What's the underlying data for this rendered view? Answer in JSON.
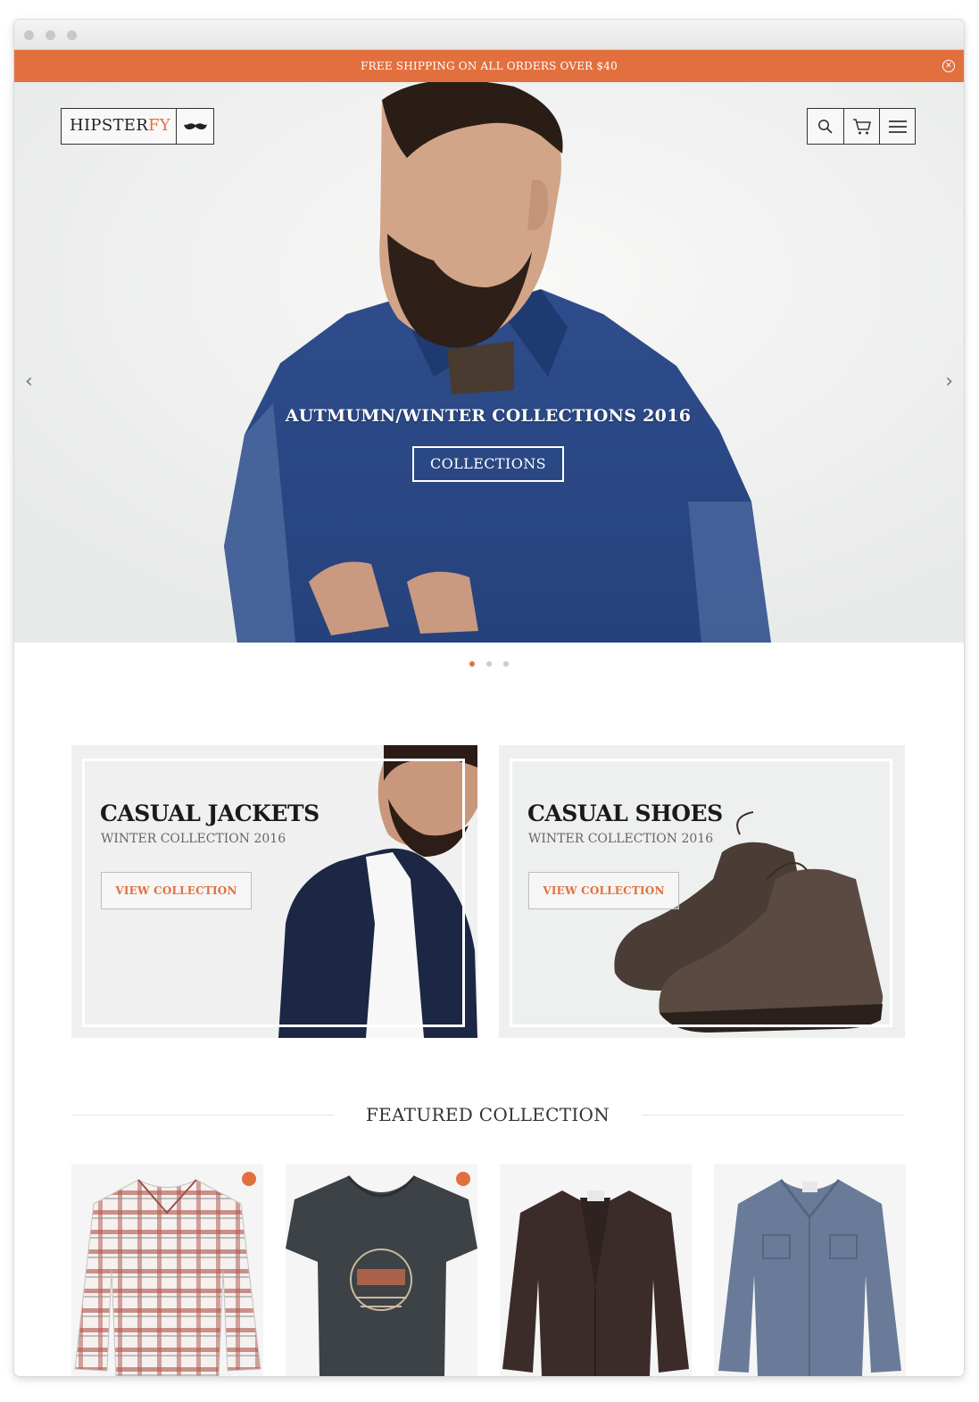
{
  "window": {
    "controls": [
      "close",
      "minimize",
      "zoom"
    ]
  },
  "announcement": {
    "text": "FREE SHIPPING ON ALL ORDERS OVER $40",
    "close_icon": "close-circle-icon"
  },
  "header": {
    "logo": {
      "text_main": "HIPSTER",
      "text_accent": "FY",
      "mark_icon": "mustache-icon"
    },
    "actions": [
      {
        "name": "search",
        "icon": "search-icon"
      },
      {
        "name": "cart",
        "icon": "cart-icon"
      },
      {
        "name": "menu",
        "icon": "hamburger-menu-icon"
      }
    ]
  },
  "hero": {
    "title": "AUTMUMN/WINTER COLLECTIONS 2016",
    "button_label": "COLLECTIONS",
    "prev_icon": "chevron-left-icon",
    "next_icon": "chevron-right-icon",
    "slides_count": 3,
    "active_slide": 1
  },
  "collections": [
    {
      "title": "CASUAL JACKETS",
      "subtitle": "WINTER COLLECTION 2016",
      "button_label": "VIEW COLLECTION"
    },
    {
      "title": "CASUAL SHOES",
      "subtitle": "WINTER COLLECTION 2016",
      "button_label": "VIEW COLLECTION"
    }
  ],
  "featured": {
    "title": "FEATURED COLLECTION",
    "products": [
      {
        "image": "plaid-flannel-shirt",
        "on_sale": true
      },
      {
        "image": "graphic-v-neck-tee",
        "on_sale": true
      },
      {
        "image": "brown-knit-cardigan",
        "on_sale": false
      },
      {
        "image": "blue-chambray-shirt",
        "on_sale": false
      }
    ]
  },
  "colors": {
    "accent": "#e2703f",
    "text_dark": "#1a1a1a",
    "text_muted": "#666666",
    "background": "#ffffff"
  }
}
